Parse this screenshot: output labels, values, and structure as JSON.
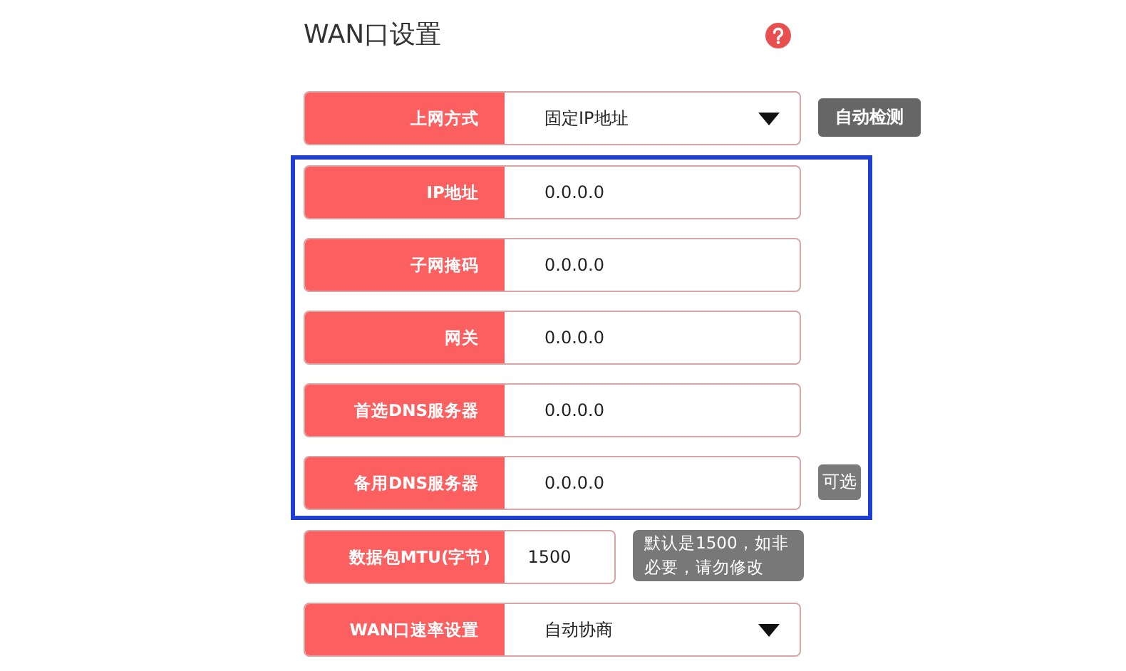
{
  "title": "WAN口设置",
  "groups": [
    {
      "highlighted": false,
      "rows": [
        {
          "kind": "select",
          "label": "上网方式",
          "value": "固定IP地址",
          "side": {
            "kind": "button",
            "text": "自动检测"
          }
        }
      ]
    },
    {
      "highlighted": true,
      "rows": [
        {
          "kind": "input",
          "label": "IP地址",
          "value": "0.0.0.0"
        },
        {
          "kind": "input",
          "label": "子网掩码",
          "value": "0.0.0.0"
        },
        {
          "kind": "input",
          "label": "网关",
          "value": "0.0.0.0"
        },
        {
          "kind": "input",
          "label": "首选DNS服务器",
          "value": "0.0.0.0"
        },
        {
          "kind": "input",
          "label": "备用DNS服务器",
          "value": "0.0.0.0",
          "side": {
            "kind": "tag",
            "text": "可选"
          }
        }
      ]
    },
    {
      "highlighted": false,
      "rows": [
        {
          "kind": "short",
          "label": "数据包MTU(字节)",
          "value": "1500",
          "side": {
            "kind": "hint",
            "text": "默认是1500，如非必要，请勿修改"
          }
        },
        {
          "kind": "select",
          "label": "WAN口速率设置",
          "value": "自动协商"
        }
      ]
    }
  ]
}
